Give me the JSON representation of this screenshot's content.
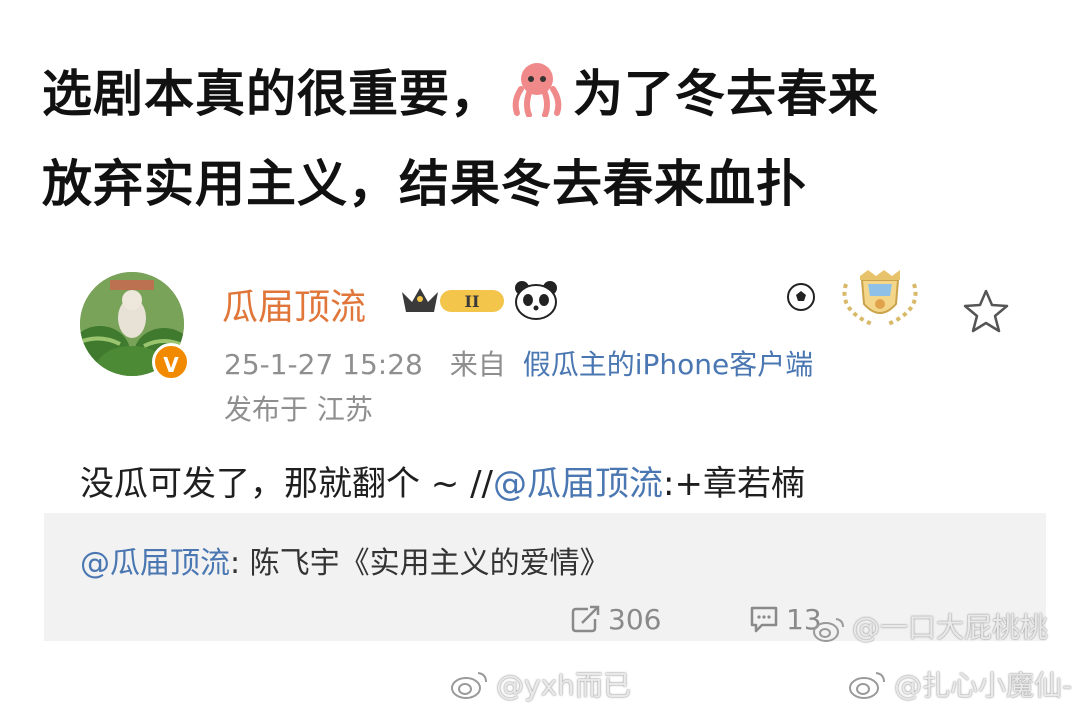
{
  "headline": {
    "line1_before": "选剧本真的很重要，",
    "octopus_icon": "octopus-emoji",
    "line1_after": "为了冬去春来",
    "line2": "放弃实用主义，结果冬去春来血扑"
  },
  "post": {
    "username": "瓜届顶流",
    "level_badge": "II",
    "timestamp": "25-1-27 15:28",
    "source_prefix": "来自",
    "source": "假瓜主的iPhone客户端",
    "location": "发布于 江苏",
    "body_text": "没瓜可发了，那就翻个 ~ //",
    "body_mention": "@瓜届顶流",
    "body_suffix": ":+章若楠",
    "retweet_mention": "@瓜届顶流",
    "retweet_text": ": 陈飞宇《实用主义的爱情》",
    "repost_count": "306",
    "comment_count": "13",
    "verified_badge": "V"
  },
  "watermarks": {
    "bottom_left": "@yxh而已",
    "bottom_right": "@扎心小魔仙-",
    "overlay": "@一口大屁桃桃"
  },
  "colors": {
    "username": "#e0763a",
    "link": "#4a77b2",
    "meta": "#8f8f8f",
    "retweet_bg": "#f2f2f2"
  }
}
